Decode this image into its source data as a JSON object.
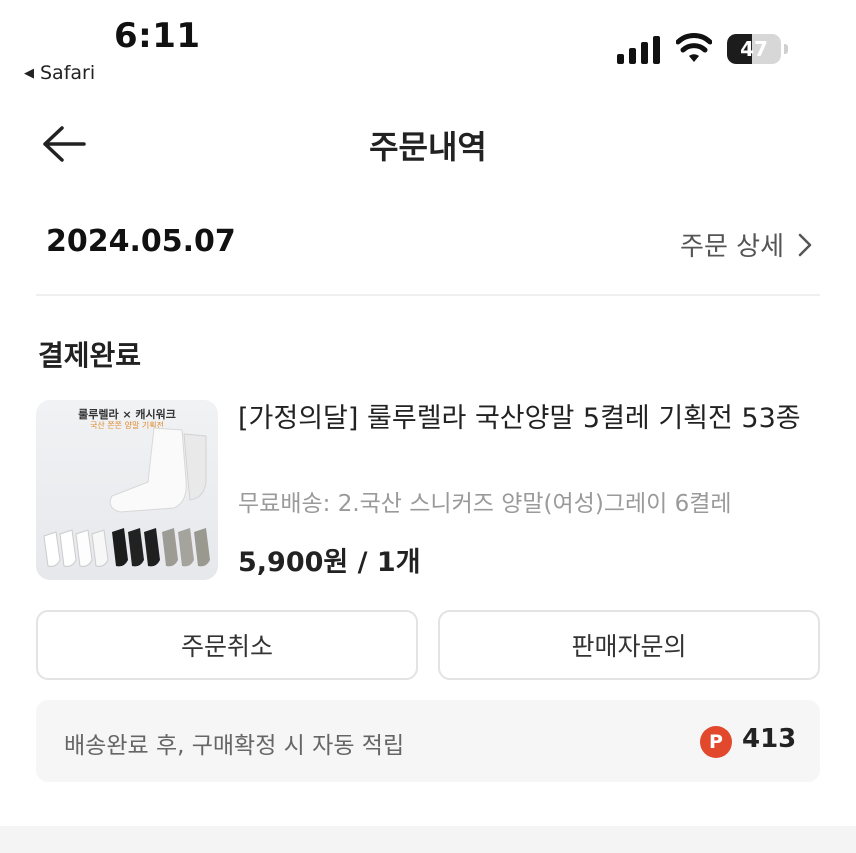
{
  "status_bar": {
    "time": "6:11",
    "back_app": "Safari",
    "battery": "47",
    "battery_level": 0.47
  },
  "header": {
    "title": "주문내역"
  },
  "order": {
    "date": "2024.05.07",
    "detail_link": "주문 상세",
    "status": "결제완료",
    "product": {
      "thumb_brand": "룰루렐라 × 캐시워크",
      "thumb_sub": "국산 쫀쫀 양말 기획전",
      "name": "[가정의달] 룰루렐라 국산양말 5켤레 기획전 53종",
      "option": "무료배송: 2.국산 스니커즈 양말(여성)그레이 6켤레",
      "price": "5,900원 / 1개"
    },
    "buttons": {
      "cancel": "주문취소",
      "inquiry": "판매자문의"
    },
    "points": {
      "text": "배송완료 후, 구매확정 시 자동 적립",
      "icon": "P",
      "value": "413"
    }
  },
  "colors": {
    "point_badge": "#e2482c"
  }
}
